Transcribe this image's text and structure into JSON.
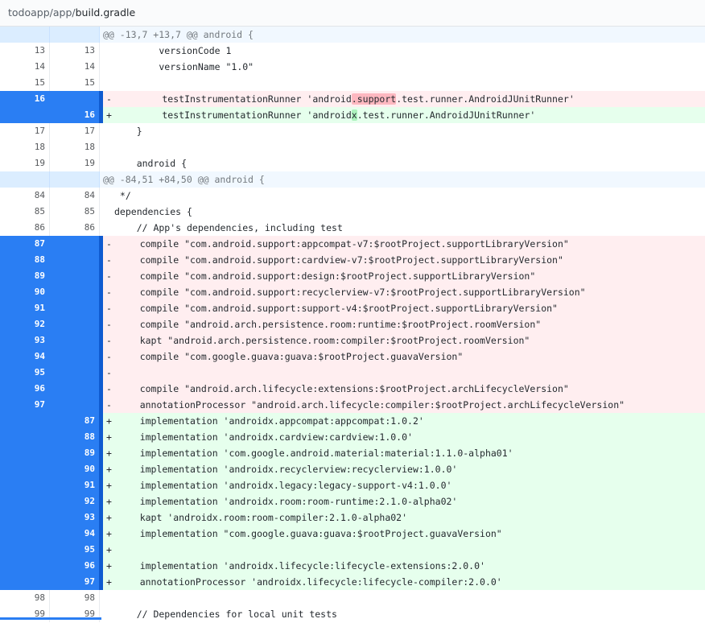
{
  "breadcrumb": {
    "path": "todoapp/app/",
    "file": "build.gradle"
  },
  "colors": {
    "selected_gutter": "#2a7ef3",
    "deleted_bg": "#ffeef0",
    "added_bg": "#e6ffed",
    "hunk_bg": "#f1f8ff"
  },
  "lines": [
    {
      "type": "hunk",
      "old": "",
      "new": "",
      "sign": "",
      "text": "@@ -13,7 +13,7 @@ android {"
    },
    {
      "type": "ctx",
      "old": "13",
      "new": "13",
      "sign": " ",
      "text": "        versionCode 1"
    },
    {
      "type": "ctx",
      "old": "14",
      "new": "14",
      "sign": " ",
      "text": "        versionName \"1.0\""
    },
    {
      "type": "ctx",
      "old": "15",
      "new": "15",
      "sign": " ",
      "text": ""
    },
    {
      "type": "del",
      "old": "16",
      "new": "",
      "sign": "-",
      "text": "        testInstrumentationRunner 'android.support.test.runner.AndroidJUnitRunner'",
      "pre": "        testInstrumentationRunner 'android",
      "hl": ".support",
      "post": ".test.runner.AndroidJUnitRunner'"
    },
    {
      "type": "add",
      "old": "",
      "new": "16",
      "sign": "+",
      "text": "        testInstrumentationRunner 'androidx.test.runner.AndroidJUnitRunner'",
      "pre": "        testInstrumentationRunner 'android",
      "hl": "x",
      "post": ".test.runner.AndroidJUnitRunner'"
    },
    {
      "type": "ctx",
      "old": "17",
      "new": "17",
      "sign": " ",
      "text": "    }"
    },
    {
      "type": "ctx",
      "old": "18",
      "new": "18",
      "sign": " ",
      "text": ""
    },
    {
      "type": "ctx",
      "old": "19",
      "new": "19",
      "sign": " ",
      "text": "    android {"
    },
    {
      "type": "hunk",
      "old": "",
      "new": "",
      "sign": "",
      "text": "@@ -84,51 +84,50 @@ android {"
    },
    {
      "type": "ctx",
      "old": "84",
      "new": "84",
      "sign": " ",
      "text": " */"
    },
    {
      "type": "ctx",
      "old": "85",
      "new": "85",
      "sign": " ",
      "text": "dependencies {"
    },
    {
      "type": "ctx",
      "old": "86",
      "new": "86",
      "sign": " ",
      "text": "    // App's dependencies, including test"
    },
    {
      "type": "del",
      "old": "87",
      "new": "",
      "sign": "-",
      "text": "    compile \"com.android.support:appcompat-v7:$rootProject.supportLibraryVersion\""
    },
    {
      "type": "del",
      "old": "88",
      "new": "",
      "sign": "-",
      "text": "    compile \"com.android.support:cardview-v7:$rootProject.supportLibraryVersion\""
    },
    {
      "type": "del",
      "old": "89",
      "new": "",
      "sign": "-",
      "text": "    compile \"com.android.support:design:$rootProject.supportLibraryVersion\""
    },
    {
      "type": "del",
      "old": "90",
      "new": "",
      "sign": "-",
      "text": "    compile \"com.android.support:recyclerview-v7:$rootProject.supportLibraryVersion\""
    },
    {
      "type": "del",
      "old": "91",
      "new": "",
      "sign": "-",
      "text": "    compile \"com.android.support:support-v4:$rootProject.supportLibraryVersion\""
    },
    {
      "type": "del",
      "old": "92",
      "new": "",
      "sign": "-",
      "text": "    compile \"android.arch.persistence.room:runtime:$rootProject.roomVersion\""
    },
    {
      "type": "del",
      "old": "93",
      "new": "",
      "sign": "-",
      "text": "    kapt \"android.arch.persistence.room:compiler:$rootProject.roomVersion\""
    },
    {
      "type": "del",
      "old": "94",
      "new": "",
      "sign": "-",
      "text": "    compile \"com.google.guava:guava:$rootProject.guavaVersion\""
    },
    {
      "type": "del",
      "old": "95",
      "new": "",
      "sign": "-",
      "text": ""
    },
    {
      "type": "del",
      "old": "96",
      "new": "",
      "sign": "-",
      "text": "    compile \"android.arch.lifecycle:extensions:$rootProject.archLifecycleVersion\""
    },
    {
      "type": "del",
      "old": "97",
      "new": "",
      "sign": "-",
      "text": "    annotationProcessor \"android.arch.lifecycle:compiler:$rootProject.archLifecycleVersion\""
    },
    {
      "type": "add",
      "old": "",
      "new": "87",
      "sign": "+",
      "text": "    implementation 'androidx.appcompat:appcompat:1.0.2'"
    },
    {
      "type": "add",
      "old": "",
      "new": "88",
      "sign": "+",
      "text": "    implementation 'androidx.cardview:cardview:1.0.0'"
    },
    {
      "type": "add",
      "old": "",
      "new": "89",
      "sign": "+",
      "text": "    implementation 'com.google.android.material:material:1.1.0-alpha01'"
    },
    {
      "type": "add",
      "old": "",
      "new": "90",
      "sign": "+",
      "text": "    implementation 'androidx.recyclerview:recyclerview:1.0.0'"
    },
    {
      "type": "add",
      "old": "",
      "new": "91",
      "sign": "+",
      "text": "    implementation 'androidx.legacy:legacy-support-v4:1.0.0'"
    },
    {
      "type": "add",
      "old": "",
      "new": "92",
      "sign": "+",
      "text": "    implementation 'androidx.room:room-runtime:2.1.0-alpha02'"
    },
    {
      "type": "add",
      "old": "",
      "new": "93",
      "sign": "+",
      "text": "    kapt 'androidx.room:room-compiler:2.1.0-alpha02'"
    },
    {
      "type": "add",
      "old": "",
      "new": "94",
      "sign": "+",
      "text": "    implementation \"com.google.guava:guava:$rootProject.guavaVersion\""
    },
    {
      "type": "add",
      "old": "",
      "new": "95",
      "sign": "+",
      "text": ""
    },
    {
      "type": "add",
      "old": "",
      "new": "96",
      "sign": "+",
      "text": "    implementation 'androidx.lifecycle:lifecycle-extensions:2.0.0'"
    },
    {
      "type": "add",
      "old": "",
      "new": "97",
      "sign": "+",
      "text": "    annotationProcessor 'androidx.lifecycle:lifecycle-compiler:2.0.0'"
    },
    {
      "type": "ctx",
      "old": "98",
      "new": "98",
      "sign": " ",
      "text": ""
    },
    {
      "type": "ctx",
      "old": "99",
      "new": "99",
      "sign": " ",
      "text": "    // Dependencies for local unit tests"
    }
  ]
}
